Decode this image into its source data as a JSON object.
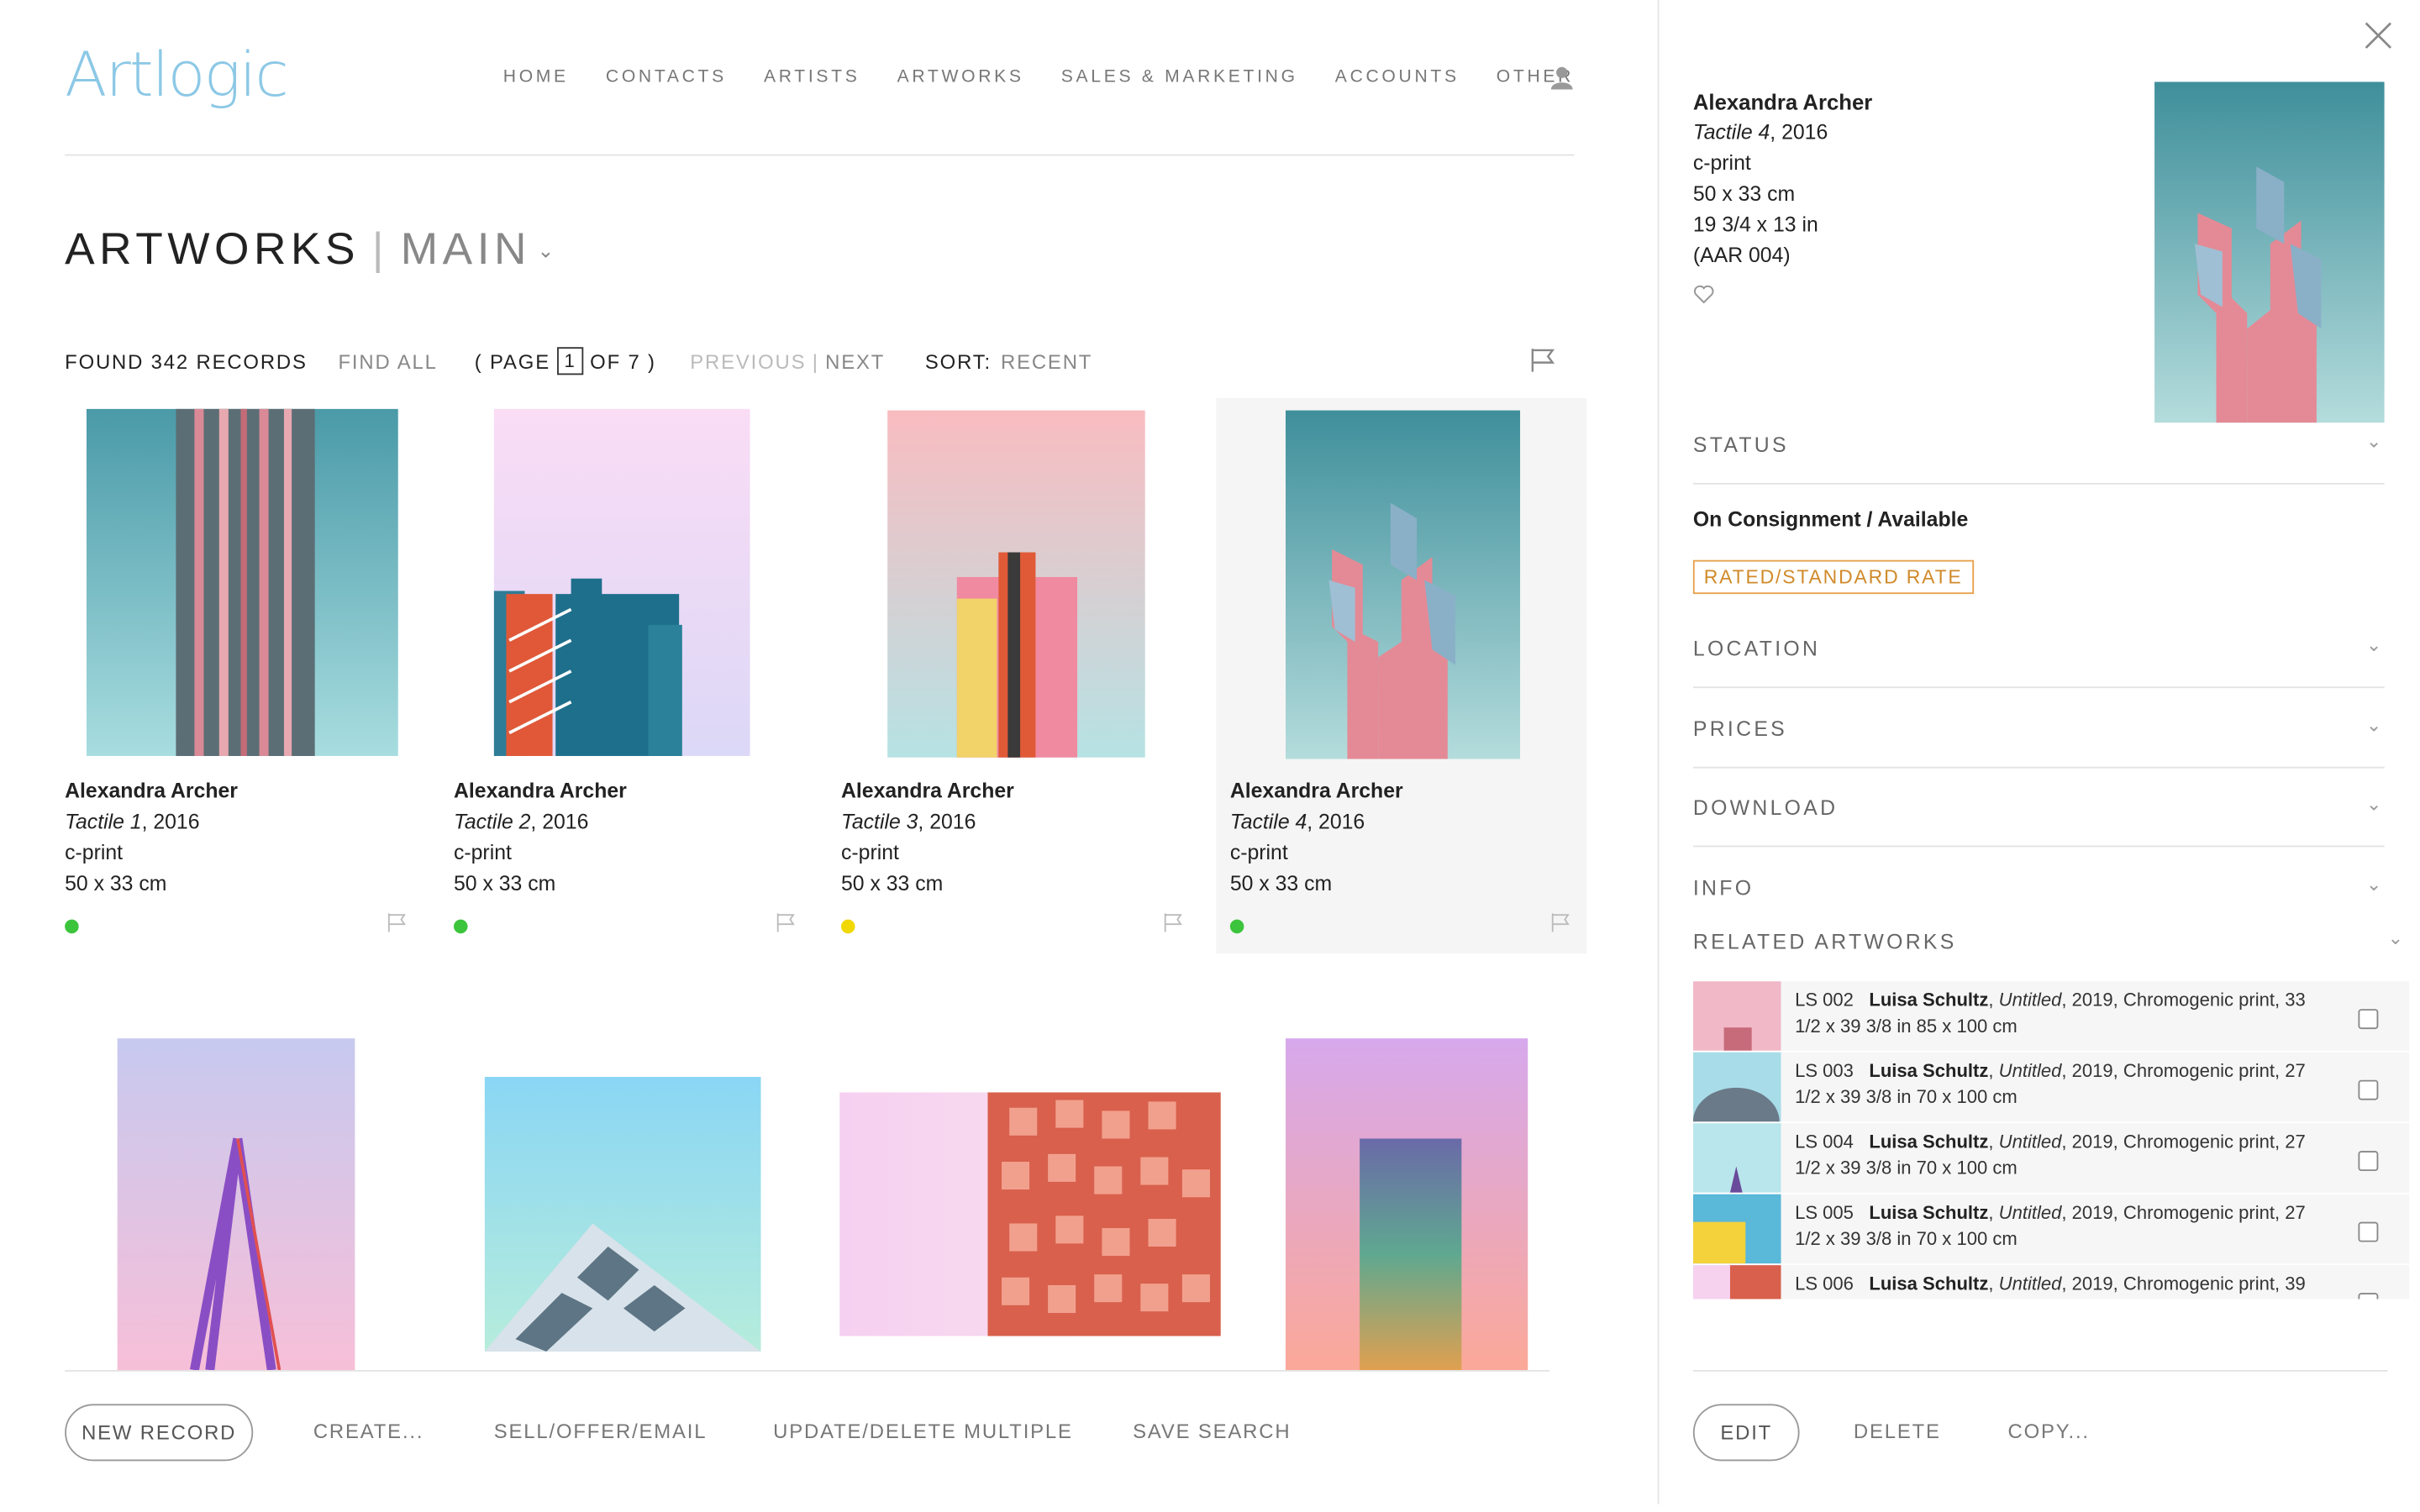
{
  "app": {
    "logo": "Artlogic"
  },
  "nav": {
    "items": [
      "HOME",
      "CONTACTS",
      "ARTISTS",
      "ARTWORKS",
      "SALES & MARKETING",
      "ACCOUNTS",
      "OTHER"
    ]
  },
  "page": {
    "title": "ARTWORKS",
    "sep": "|",
    "subtitle": "MAIN"
  },
  "toolbar": {
    "found": "FOUND 342 RECORDS",
    "find_all": "FIND ALL",
    "page_prefix": "( PAGE",
    "page_num": "1",
    "page_suffix": "OF 7 )",
    "previous": "PREVIOUS",
    "pipe": "|",
    "next": "NEXT",
    "sort_label": "SORT:",
    "sort_value": "RECENT"
  },
  "artworks": [
    {
      "artist": "Alexandra Archer",
      "title": "Tactile 1",
      "year": ", 2016",
      "medium": "c-print",
      "size": "50 x 33 cm",
      "status_color": "#3cc43c"
    },
    {
      "artist": "Alexandra Archer",
      "title": "Tactile 2",
      "year": ", 2016",
      "medium": "c-print",
      "size": "50 x 33 cm",
      "status_color": "#3cc43c"
    },
    {
      "artist": "Alexandra Archer",
      "title": "Tactile 3",
      "year": ", 2016",
      "medium": "c-print",
      "size": "50 x 33 cm",
      "status_color": "#f0d800"
    },
    {
      "artist": "Alexandra Archer",
      "title": "Tactile 4",
      "year": ", 2016",
      "medium": "c-print",
      "size": "50 x 33 cm",
      "status_color": "#3cc43c"
    }
  ],
  "bottom": {
    "new_record": "NEW RECORD",
    "create": "CREATE...",
    "sell": "SELL/OFFER/EMAIL",
    "update": "UPDATE/DELETE MULTIPLE",
    "save_search": "SAVE SEARCH"
  },
  "panel": {
    "artist": "Alexandra Archer",
    "title": "Tactile 4",
    "year": ", 2016",
    "medium": "c-print",
    "size_cm": "50 x 33 cm",
    "size_in": "19 3/4 x 13 in",
    "ref": "(AAR 004)",
    "sections": {
      "status": "STATUS",
      "location": "LOCATION",
      "prices": "PRICES",
      "download": "DOWNLOAD",
      "info": "INFO",
      "related": "RELATED ARTWORKS"
    },
    "status_value": "On Consignment / Available",
    "rate": "RATED/STANDARD RATE",
    "related": [
      {
        "code": "LS 002",
        "artist": "Luisa Schultz",
        "title": "Untitled",
        "rest": ", 2019, Chromogenic print, 33 1/2 x 39 3/8 in 85 x 100 cm"
      },
      {
        "code": "LS 003",
        "artist": "Luisa Schultz",
        "title": "Untitled",
        "rest": ", 2019, Chromogenic print, 27 1/2 x 39 3/8 in 70 x 100 cm"
      },
      {
        "code": "LS 004",
        "artist": "Luisa Schultz",
        "title": "Untitled",
        "rest": ", 2019, Chromogenic print, 27 1/2 x 39 3/8 in 70 x 100 cm"
      },
      {
        "code": "LS 005",
        "artist": "Luisa Schultz",
        "title": "Untitled",
        "rest": ", 2019, Chromogenic print, 27 1/2 x 39 3/8 in 70 x 100 cm"
      },
      {
        "code": "LS 006",
        "artist": "Luisa Schultz",
        "title": "Untitled",
        "rest": ", 2019, Chromogenic print, 39"
      }
    ],
    "edit": "EDIT",
    "delete": "DELETE",
    "copy": "COPY..."
  }
}
